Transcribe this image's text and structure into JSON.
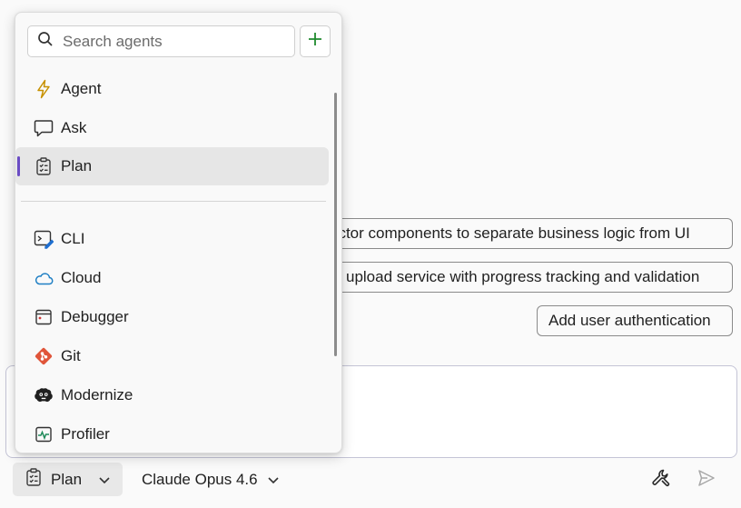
{
  "suggestions": [
    "actor components to separate business logic from UI",
    "upload service with progress tracking and validation",
    "Add user authentication"
  ],
  "dropdown": {
    "search_placeholder": "Search agents",
    "add_icon": "plus-icon",
    "items": [
      {
        "label": "Agent",
        "icon": "lightning-icon",
        "selected": false
      },
      {
        "label": "Ask",
        "icon": "chat-bubble-icon",
        "selected": false
      },
      {
        "label": "Plan",
        "icon": "clipboard-checklist-icon",
        "selected": true
      },
      {
        "label": "CLI",
        "icon": "terminal-edit-icon",
        "selected": false
      },
      {
        "label": "Cloud",
        "icon": "cloud-icon",
        "selected": false
      },
      {
        "label": "Debugger",
        "icon": "debugger-icon",
        "selected": false
      },
      {
        "label": "Git",
        "icon": "git-icon",
        "selected": false
      },
      {
        "label": "Modernize",
        "icon": "modernize-icon",
        "selected": false
      },
      {
        "label": "Profiler",
        "icon": "profiler-icon",
        "selected": false
      }
    ]
  },
  "toolbar": {
    "mode_label": "Plan",
    "model_label": "Claude Opus 4.6",
    "tools_icon": "wrench-screwdriver-icon",
    "send_icon": "send-icon"
  },
  "colors": {
    "accent": "#6a4cc4",
    "add_green": "#1f8a2e",
    "agent_icon": "#c79100",
    "cloud_icon": "#1f7fc4",
    "git_icon": "#e0553a",
    "cli_pen": "#1f6fd0"
  }
}
